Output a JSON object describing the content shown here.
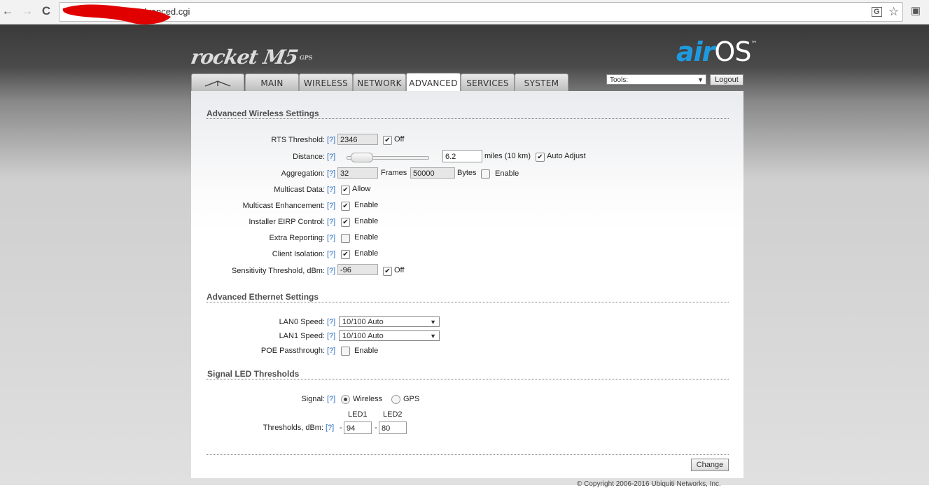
{
  "browser": {
    "url": "dvanced.cgi",
    "back_icon": "←",
    "forward_icon": "→",
    "reload_icon": "C",
    "translate_icon": "G",
    "star_icon": "☆",
    "ext_icon": "▣"
  },
  "header": {
    "product": "rocket M5",
    "product_sub": "GPS",
    "airos_air": "air",
    "airos_os": "OS",
    "airos_tm": "™"
  },
  "tabs": [
    {
      "label": "",
      "icon": "ubiquiti-logo-icon"
    },
    {
      "label": "MAIN"
    },
    {
      "label": "WIRELESS"
    },
    {
      "label": "NETWORK"
    },
    {
      "label": "ADVANCED"
    },
    {
      "label": "SERVICES"
    },
    {
      "label": "SYSTEM"
    }
  ],
  "tools": {
    "selected": "Tools:",
    "arrow": "▼"
  },
  "logout_label": "Logout",
  "help": "[?]",
  "wireless": {
    "title": "Advanced Wireless Settings",
    "rts": {
      "label": "RTS Threshold:",
      "value": "2346",
      "check_label": "Off",
      "checked": true
    },
    "distance": {
      "label": "Distance:",
      "value": "6.2",
      "unit": "miles (10 km)",
      "auto_label": "Auto Adjust",
      "auto_checked": true
    },
    "aggregation": {
      "label": "Aggregation:",
      "frames_value": "32",
      "frames_label": "Frames",
      "bytes_value": "50000",
      "bytes_label": "Bytes",
      "enable_label": "Enable",
      "checked": false
    },
    "multicast_data": {
      "label": "Multicast Data:",
      "check_label": "Allow",
      "checked": true
    },
    "multicast_enh": {
      "label": "Multicast Enhancement:",
      "check_label": "Enable",
      "checked": true
    },
    "installer_eirp": {
      "label": "Installer EIRP Control:",
      "check_label": "Enable",
      "checked": true
    },
    "extra_reporting": {
      "label": "Extra Reporting:",
      "check_label": "Enable",
      "checked": false
    },
    "client_isolation": {
      "label": "Client Isolation:",
      "check_label": "Enable",
      "checked": true
    },
    "sensitivity": {
      "label": "Sensitivity Threshold, dBm:",
      "value": "-96",
      "check_label": "Off",
      "checked": true
    }
  },
  "ethernet": {
    "title": "Advanced Ethernet Settings",
    "lan0": {
      "label": "LAN0 Speed:",
      "value": "10/100 Auto"
    },
    "lan1": {
      "label": "LAN1 Speed:",
      "value": "10/100 Auto"
    },
    "poe": {
      "label": "POE Passthrough:",
      "check_label": "Enable",
      "checked": false
    },
    "select_arrow": "▼"
  },
  "led": {
    "title": "Signal LED Thresholds",
    "signal_label": "Signal:",
    "opt_wireless": "Wireless",
    "opt_gps": "GPS",
    "led1_label": "LED1",
    "led2_label": "LED2",
    "thresholds_label": "Thresholds, dBm:",
    "dash": "-",
    "led1_value": "94",
    "led2_value": "80"
  },
  "change_label": "Change",
  "footer": "© Copyright 2006-2016 Ubiquiti Networks, Inc.",
  "checkmark": "✔"
}
